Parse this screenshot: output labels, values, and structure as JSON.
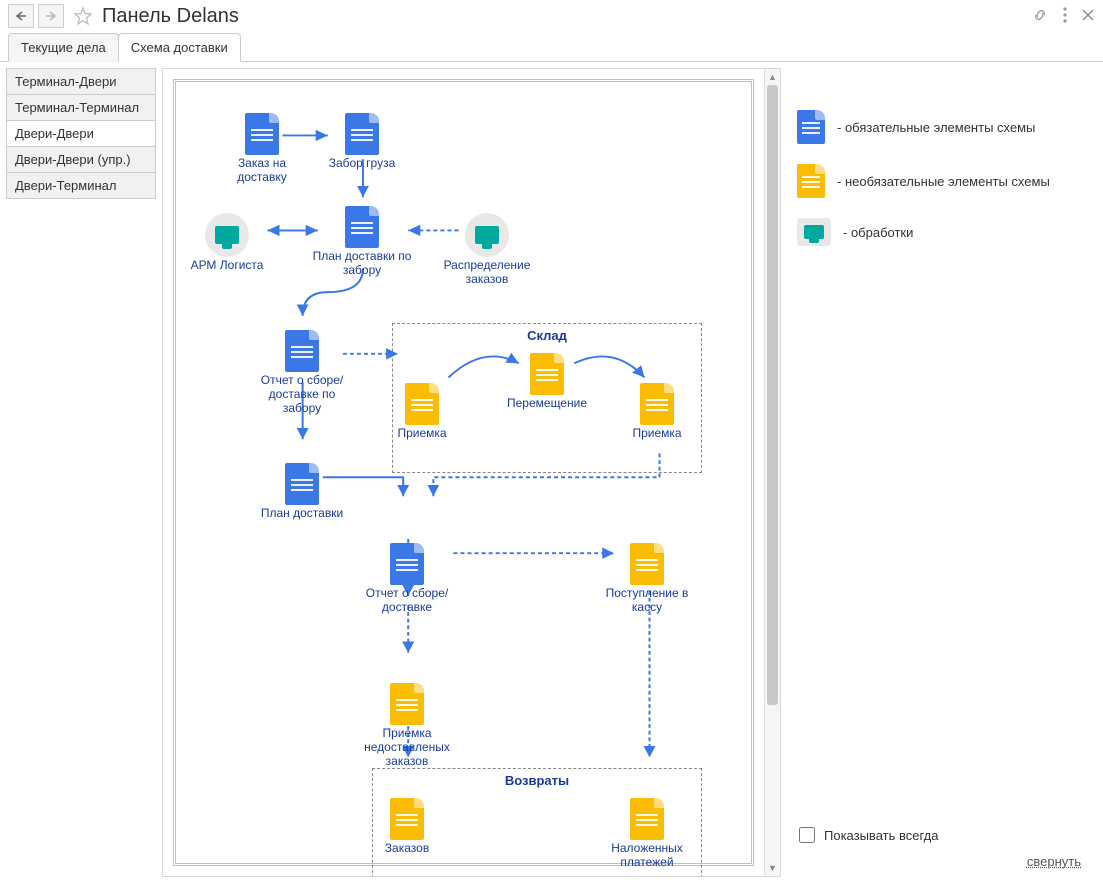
{
  "header": {
    "title": "Панель Delans"
  },
  "tabs": [
    {
      "label": "Текущие дела",
      "active": false
    },
    {
      "label": "Схема доставки",
      "active": true
    }
  ],
  "sidebar": {
    "items": [
      {
        "label": "Терминал-Двери",
        "active": false
      },
      {
        "label": "Терминал-Терминал",
        "active": false
      },
      {
        "label": "Двери-Двери",
        "active": true
      },
      {
        "label": "Двери-Двери (упр.)",
        "active": false
      },
      {
        "label": "Двери-Терминал",
        "active": false
      }
    ]
  },
  "legend": {
    "required": "- обязательные элементы схемы",
    "optional": "- необязательные элементы схемы",
    "processing": "- обработки"
  },
  "footer": {
    "show_always": "Показывать всегда",
    "collapse": "свернуть"
  },
  "diagram": {
    "groups": {
      "warehouse": "Склад",
      "returns": "Возвраты"
    },
    "nodes": {
      "order": "Заказ на доставку",
      "pickup": "Забор груза",
      "arm": "АРМ Логиста",
      "plan_pickup": "План доставки по забору",
      "distribution": "Распределение заказов",
      "report_pickup": "Отчет о сборе/доставке по забору",
      "priemka1": "Приемка",
      "move": "Перемещение",
      "priemka2": "Приемка",
      "plan_delivery": "План доставки",
      "report_delivery": "Отчет о сборе/доставке",
      "cash_in": "Поступление в кассу",
      "priemka_undeliv": "Приемка недоставленых заказов",
      "ret_orders": "Заказов",
      "ret_cod": "Наложенных платежей"
    }
  }
}
